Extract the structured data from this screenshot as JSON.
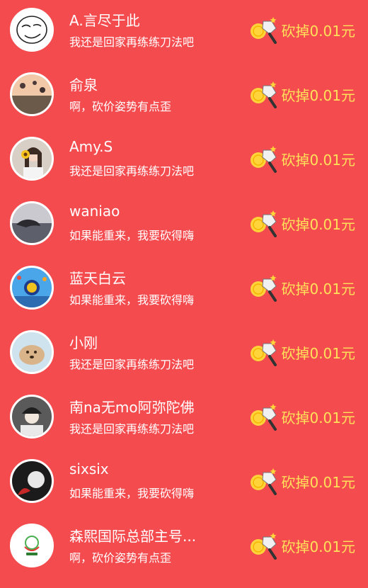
{
  "entries": [
    {
      "name": "A.言尽于此",
      "message": "我还是回家再练练刀法吧",
      "cut": "砍掉0.01元",
      "avatar": "cartoon-face-avatar"
    },
    {
      "name": "俞泉",
      "message": "啊，砍价姿势有点歪",
      "cut": "砍掉0.01元",
      "avatar": "hot-air-balloons-avatar"
    },
    {
      "name": "Amy.S",
      "message": "我还是回家再练练刀法吧",
      "cut": "砍掉0.01元",
      "avatar": "girl-with-sunflower-avatar"
    },
    {
      "name": "waniao",
      "message": "如果能重来，我要砍得嗨",
      "cut": "砍掉0.01元",
      "avatar": "hand-sunset-avatar"
    },
    {
      "name": "蓝天白云",
      "message": "如果能重来，我要砍得嗨",
      "cut": "砍掉0.01元",
      "avatar": "blue-balloons-avatar"
    },
    {
      "name": "小刚",
      "message": "我还是回家再练练刀法吧",
      "cut": "砍掉0.01元",
      "avatar": "puppy-avatar"
    },
    {
      "name": "南na无mo阿弥陀佛",
      "message": "我还是回家再练练刀法吧",
      "cut": "砍掉0.01元",
      "avatar": "person-in-hat-avatar"
    },
    {
      "name": "sixsix",
      "message": "如果能重来，我要砍得嗨",
      "cut": "砍掉0.01元",
      "avatar": "dark-illustration-avatar"
    },
    {
      "name": "森熙国际总部主号...",
      "message": "啊，砍价姿势有点歪",
      "cut": "砍掉0.01元",
      "avatar": "green-logo-avatar"
    }
  ],
  "colors": {
    "background": "#f44b4f",
    "accent_text": "#ffe15a",
    "text": "#ffffff"
  },
  "icons": {
    "cut_icon": "cleaver-with-coin-icon"
  }
}
